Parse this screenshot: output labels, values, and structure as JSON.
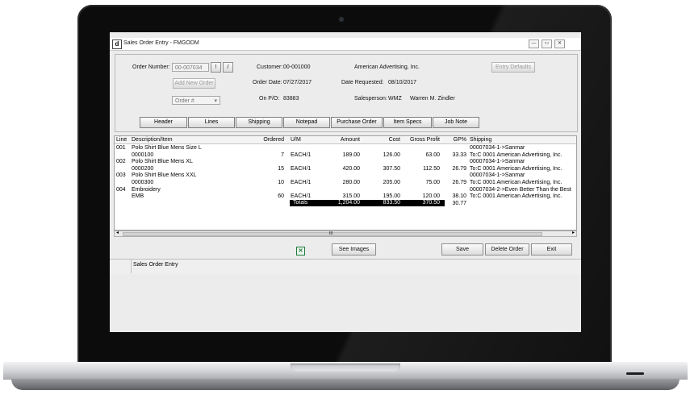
{
  "window": {
    "app_icon": "d",
    "title": "Sales Order Entry - FMGODM",
    "min": "—",
    "max": "▭",
    "close": "✕"
  },
  "order": {
    "order_number_label": "Order Number:",
    "order_number_value": "00-007034",
    "add_new_order": "Add New Order",
    "order_hash_select": "Order #",
    "customer_label": "Customer:",
    "customer_id": "00-001000",
    "customer_name": "American Advertising, Inc.",
    "order_date_label": "Order Date:",
    "order_date": "07/27/2017",
    "date_requested_label": "Date Requested:",
    "date_requested": "08/10/2017",
    "po_label": "On P/O:",
    "po_value": "83883",
    "salesperson_label": "Salesperson:",
    "salesperson_code": "WMZ",
    "salesperson_name": "Warren M. Zindler",
    "entry_defaults": "Entry Defaults"
  },
  "tabs": [
    {
      "label": "Header"
    },
    {
      "label": "Lines"
    },
    {
      "label": "Shipping"
    },
    {
      "label": "Notepad"
    },
    {
      "label": "Purchase Order"
    },
    {
      "label": "Item Specs"
    },
    {
      "label": "Job Note"
    }
  ],
  "grid": {
    "headers": {
      "line": "Line",
      "desc": "Description/Item",
      "ordered": "Ordered",
      "um": "U/M",
      "amount": "Amount",
      "cost": "Cost",
      "gp": "Gross Profit",
      "gpp": "GP%",
      "ship": "Shipping"
    },
    "rows": [
      {
        "line": "001",
        "desc": "Polo Shirt Blue Mens Size L",
        "ordered": "",
        "um": "",
        "amount": "",
        "cost": "",
        "gp": "",
        "gpp": "",
        "ship": "00007034-1->Sanmar"
      },
      {
        "line": "",
        "desc": "0000100",
        "ordered": "7",
        "um": "EACH/1",
        "amount": "189.00",
        "cost": "126.00",
        "gp": "63.00",
        "gpp": "33.33",
        "ship": "To:C 0001 American Advertising, Inc."
      },
      {
        "line": "002",
        "desc": "Polo Shirt Blue Mens XL",
        "ordered": "",
        "um": "",
        "amount": "",
        "cost": "",
        "gp": "",
        "gpp": "",
        "ship": "00007034-1->Sanmar"
      },
      {
        "line": "",
        "desc": "0000200",
        "ordered": "15",
        "um": "EACH/1",
        "amount": "420.00",
        "cost": "307.50",
        "gp": "112.50",
        "gpp": "26.79",
        "ship": "To:C 0001 American Advertising, Inc."
      },
      {
        "line": "003",
        "desc": "Polo Shirt Blue Mens XXL",
        "ordered": "",
        "um": "",
        "amount": "",
        "cost": "",
        "gp": "",
        "gpp": "",
        "ship": "00007034-1->Sanmar"
      },
      {
        "line": "",
        "desc": "0000300",
        "ordered": "10",
        "um": "EACH/1",
        "amount": "280.00",
        "cost": "205.00",
        "gp": "75.00",
        "gpp": "26.79",
        "ship": "To:C 0001 American Advertising, Inc."
      },
      {
        "line": "004",
        "desc": "Embroidery",
        "ordered": "",
        "um": "",
        "amount": "",
        "cost": "",
        "gp": "",
        "gpp": "",
        "ship": "00007034-2->Even Better Than the Best"
      },
      {
        "line": "",
        "desc": "EMB",
        "ordered": "60",
        "um": "EACH/1",
        "amount": "315.00",
        "cost": "195.00",
        "gp": "120.00",
        "gpp": "38.10",
        "ship": "To:C 0001 American Advertising, Inc."
      }
    ],
    "totals": {
      "label": "Totals",
      "amount": "1,204.00",
      "cost": "833.50",
      "gp": "370.50",
      "gpp": "30.77"
    },
    "scroll_mid": "III"
  },
  "actions": {
    "see_images": "See Images",
    "save": "Save",
    "delete_order": "Delete Order",
    "exit": "Exit"
  },
  "status": {
    "text": "Sales Order Entry"
  },
  "colors": {
    "excel_icon": "#1e7a3a"
  }
}
